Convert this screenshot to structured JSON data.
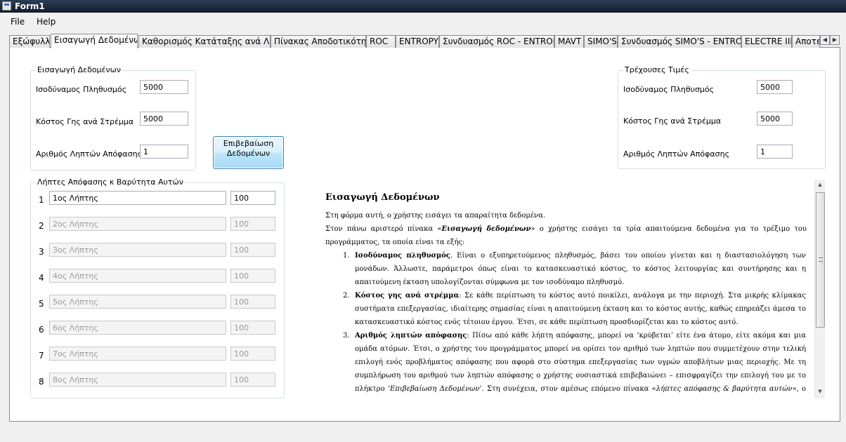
{
  "window": {
    "title": "Form1"
  },
  "menu": {
    "file": "File",
    "help": "Help"
  },
  "tabs": [
    "Εξώφυλλο",
    "Εισαγωγή Δεδομένων",
    "Καθορισμός Κατάταξης ανά Λήπτη",
    "Πίνακας Αποδοτικότητας",
    "ROC",
    "ENTROPY",
    "Συνδυασμός ROC - ENTROPY",
    "MAVT",
    "SIMO'S",
    "Συνδυασμός SIMO'S - ENTROPY",
    "ELECTRE III",
    "Αποτε"
  ],
  "input_group": {
    "title": "Εισαγωγή Δεδομένων",
    "population_label": "Ισοδύναμος Πληθυσμός",
    "population_value": "5000",
    "land_cost_label": "Κόστος Γης ανά Στρέμμα",
    "land_cost_value": "5000",
    "decision_makers_label": "Αριθμός Ληπτών Απόφασης",
    "decision_makers_value": "1"
  },
  "confirm_button": {
    "line1": "Επιβεβαίωση",
    "line2": "Δεδομένων"
  },
  "current_group": {
    "title": "Τρέχουσες Τιμές",
    "population_label": "Ισοδύναμος Πληθυσμός",
    "population_value": "5000",
    "land_cost_label": "Κόστος Γης ανά Στρέμμα",
    "land_cost_value": "5000",
    "decision_makers_label": "Αριθμός Ληπτών Απόφασης",
    "decision_makers_value": "1"
  },
  "makers_group": {
    "title": "Λήπτες Απόφασης κ Βαρύτητα Αυτών",
    "rows": [
      {
        "num": "1",
        "name": "1ος Λήπτης",
        "weight": "100"
      },
      {
        "num": "2",
        "name": "2ος Λήπτης",
        "weight": "100"
      },
      {
        "num": "3",
        "name": "3ος Λήπτης",
        "weight": "100"
      },
      {
        "num": "4",
        "name": "4ος Λήπτης",
        "weight": "100"
      },
      {
        "num": "5",
        "name": "5ος Λήπτης",
        "weight": "100"
      },
      {
        "num": "6",
        "name": "6ος Λήπτης",
        "weight": "100"
      },
      {
        "num": "7",
        "name": "7ος Λήπτης",
        "weight": "100"
      },
      {
        "num": "8",
        "name": "8ος Λήπτης",
        "weight": "100"
      }
    ]
  },
  "document": {
    "heading": "Εισαγωγή Δεδομένων",
    "p1": "Στη φόρμα αυτή, ο χρήστης εισάγει τα απαραίτητα δεδομένα.",
    "p2_a": "Στον πάνω αριστερό πίνακα «",
    "p2_em": "Εισαγωγή δεδομένων",
    "p2_b": "» ο χρήστης εισάγει τα τρία απαιτούμενα δεδομένα για το τρέξιμο του προγράμματος, τα οποία είναι τα εξής:",
    "items": [
      {
        "num": "1.",
        "term": "Ισοδύναμος πληθυσμός",
        "text": ". Είναι ο εξυπηρετούμενος πληθυσμός, βάσει του οποίου γίνεται και η διαστασιολόγηση των μονάδων. Άλλωστε, παράμετροι όπως είναι το κατασκευαστικό κόστος, το κόστος λειτουργίας και συντήρησης και η απαιτούμενη έκταση υπολογίζονται σύμφωνα με τον ισοδύναμο πληθυσμό."
      },
      {
        "num": "2.",
        "term": "Κόστος γης ανά στρέμμα",
        "text": ": Σε κάθε περίπτωση το κόστος αυτό ποικίλει, ανάλογα με την περιοχή. Στα μικρής κλίμακας συστήματα επεξεργασίας, ιδιαίτερης σημασίας είναι η απαιτούμενη έκταση και το κόστος αυτής, καθώς επηρεάζει άμεσα το κατασκευαστικό κόστος ενός τέτοιου έργου. Έτσι, σε κάθε περίπτωση προσδιορίζεται και το κόστος αυτό."
      },
      {
        "num": "3.",
        "term": "Αριθμός ληπτών απόφασης",
        "text": ": Πίσω από κάθε λήπτη απόφασης, μπορεί να ‘κρύβεται’ είτε ένα άτομο, είτε ακόμα και μια ομάδα ατόμων. Έτσι, ο χρήστης του προγράμματος μπορεί να ορίσει τον αριθμό των ληπτών που συμμετέχουν στην τελική επιλογή ενός προβλήματος απόφασης που αφορά στο σύστημα επεξεργασίας των υγρών αποβλήτων μιας περιοχής. Με τη συμπλήρωση του αριθμού των ληπτών απόφασης ο χρήστης ουσιαστικά επιβεβαιώνει – επισφραγίζει την επιλογή του με το πλήκτρο ‘",
        "em2": "Επιβεβαίωση Δεδομένων",
        "text2": "’. Στη συνέχεια, στον αμέσως επόμενο πίνακα «",
        "em3": "λήπτες απόφασης & βαρύτητα αυτών",
        "text3": "», ο χρήστης έχει τη δυνατότητα να"
      }
    ]
  }
}
